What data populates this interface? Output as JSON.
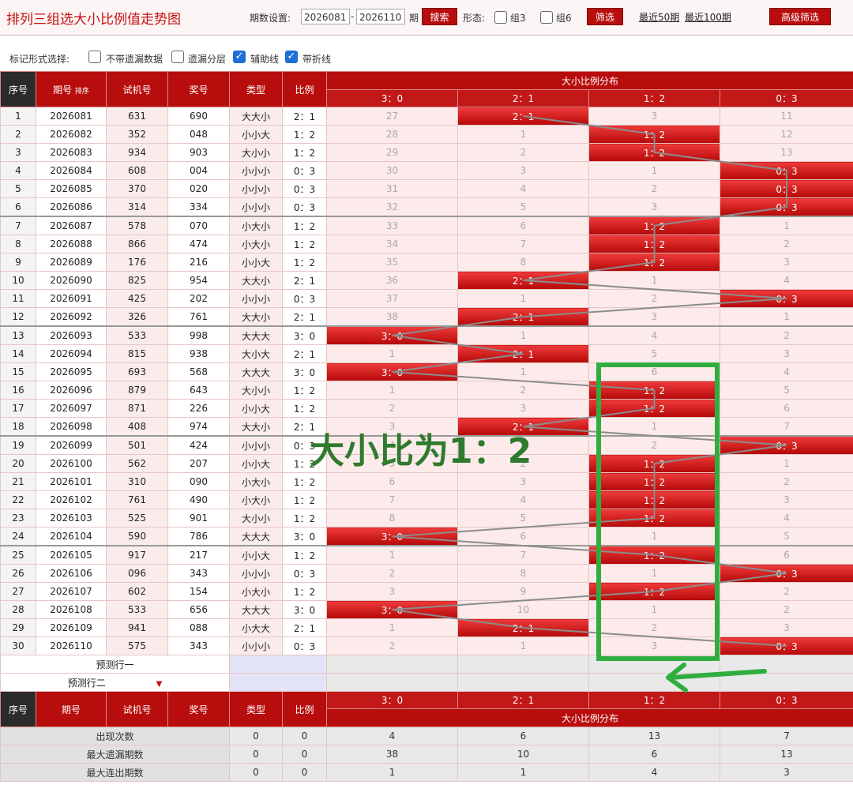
{
  "header": {
    "title": "排列三组选大小比例值走势图",
    "period_label": "期数设置:",
    "start": "2026081",
    "dash": "-",
    "end": "2026110",
    "period_suffix": "期",
    "search": "搜索",
    "shape_label": "形态:",
    "g3": "组3",
    "g6": "组6",
    "filter": "筛选",
    "recent50": "最近50期",
    "recent100": "最近100期",
    "advanced": "高级筛选"
  },
  "options": {
    "label": "标记形式选择:",
    "items": [
      {
        "label": "不带遗漏数据",
        "checked": false
      },
      {
        "label": "遗漏分层",
        "checked": false
      },
      {
        "label": "辅助线",
        "checked": true
      },
      {
        "label": "带折线",
        "checked": true
      }
    ]
  },
  "table": {
    "headers": {
      "seq": "序号",
      "issue": "期号",
      "sort": "排序",
      "test": "试机号",
      "prize": "奖号",
      "type": "类型",
      "ratio": "比例",
      "dist": "大小比例分布"
    },
    "columns": [
      "3：0",
      "2：1",
      "1：2",
      "0：3"
    ],
    "rows": [
      {
        "seq": "1",
        "issue": "2026081",
        "test": "631",
        "prize": "690",
        "type": "大大小",
        "ratio": "2：1",
        "d": [
          "27",
          "2：1",
          "3",
          "11"
        ],
        "hit": 1
      },
      {
        "seq": "2",
        "issue": "2026082",
        "test": "352",
        "prize": "048",
        "type": "小小大",
        "ratio": "1：2",
        "d": [
          "28",
          "1",
          "1：2",
          "12"
        ],
        "hit": 2
      },
      {
        "seq": "3",
        "issue": "2026083",
        "test": "934",
        "prize": "903",
        "type": "大小小",
        "ratio": "1：2",
        "d": [
          "29",
          "2",
          "1：2",
          "13"
        ],
        "hit": 2
      },
      {
        "seq": "4",
        "issue": "2026084",
        "test": "608",
        "prize": "004",
        "type": "小小小",
        "ratio": "0：3",
        "d": [
          "30",
          "3",
          "1",
          "0：3"
        ],
        "hit": 3
      },
      {
        "seq": "5",
        "issue": "2026085",
        "test": "370",
        "prize": "020",
        "type": "小小小",
        "ratio": "0：3",
        "d": [
          "31",
          "4",
          "2",
          "0：3"
        ],
        "hit": 3
      },
      {
        "seq": "6",
        "issue": "2026086",
        "test": "314",
        "prize": "334",
        "type": "小小小",
        "ratio": "0：3",
        "d": [
          "32",
          "5",
          "3",
          "0：3"
        ],
        "hit": 3
      },
      {
        "seq": "7",
        "issue": "2026087",
        "test": "578",
        "prize": "070",
        "type": "小大小",
        "ratio": "1：2",
        "d": [
          "33",
          "6",
          "1：2",
          "1"
        ],
        "hit": 2
      },
      {
        "seq": "8",
        "issue": "2026088",
        "test": "866",
        "prize": "474",
        "type": "小大小",
        "ratio": "1：2",
        "d": [
          "34",
          "7",
          "1：2",
          "2"
        ],
        "hit": 2
      },
      {
        "seq": "9",
        "issue": "2026089",
        "test": "176",
        "prize": "216",
        "type": "小小大",
        "ratio": "1：2",
        "d": [
          "35",
          "8",
          "1：2",
          "3"
        ],
        "hit": 2
      },
      {
        "seq": "10",
        "issue": "2026090",
        "test": "825",
        "prize": "954",
        "type": "大大小",
        "ratio": "2：1",
        "d": [
          "36",
          "2：1",
          "1",
          "4"
        ],
        "hit": 1
      },
      {
        "seq": "11",
        "issue": "2026091",
        "test": "425",
        "prize": "202",
        "type": "小小小",
        "ratio": "0：3",
        "d": [
          "37",
          "1",
          "2",
          "0：3"
        ],
        "hit": 3
      },
      {
        "seq": "12",
        "issue": "2026092",
        "test": "326",
        "prize": "761",
        "type": "大大小",
        "ratio": "2：1",
        "d": [
          "38",
          "2：1",
          "3",
          "1"
        ],
        "hit": 1
      },
      {
        "seq": "13",
        "issue": "2026093",
        "test": "533",
        "prize": "998",
        "type": "大大大",
        "ratio": "3：0",
        "d": [
          "3：0",
          "1",
          "4",
          "2"
        ],
        "hit": 0
      },
      {
        "seq": "14",
        "issue": "2026094",
        "test": "815",
        "prize": "938",
        "type": "大小大",
        "ratio": "2：1",
        "d": [
          "1",
          "2：1",
          "5",
          "3"
        ],
        "hit": 1
      },
      {
        "seq": "15",
        "issue": "2026095",
        "test": "693",
        "prize": "568",
        "type": "大大大",
        "ratio": "3：0",
        "d": [
          "3：0",
          "1",
          "6",
          "4"
        ],
        "hit": 0
      },
      {
        "seq": "16",
        "issue": "2026096",
        "test": "879",
        "prize": "643",
        "type": "大小小",
        "ratio": "1：2",
        "d": [
          "1",
          "2",
          "1：2",
          "5"
        ],
        "hit": 2
      },
      {
        "seq": "17",
        "issue": "2026097",
        "test": "871",
        "prize": "226",
        "type": "小小大",
        "ratio": "1：2",
        "d": [
          "2",
          "3",
          "1：2",
          "6"
        ],
        "hit": 2
      },
      {
        "seq": "18",
        "issue": "2026098",
        "test": "408",
        "prize": "974",
        "type": "大大小",
        "ratio": "2：1",
        "d": [
          "3",
          "2：1",
          "1",
          "7"
        ],
        "hit": 1
      },
      {
        "seq": "19",
        "issue": "2026099",
        "test": "501",
        "prize": "424",
        "type": "小小小",
        "ratio": "0：3",
        "d": [
          "4",
          "1",
          "2",
          "0：3"
        ],
        "hit": 3
      },
      {
        "seq": "20",
        "issue": "2026100",
        "test": "562",
        "prize": "207",
        "type": "小小大",
        "ratio": "1：2",
        "d": [
          "5",
          "2",
          "1：2",
          "1"
        ],
        "hit": 2
      },
      {
        "seq": "21",
        "issue": "2026101",
        "test": "310",
        "prize": "090",
        "type": "小大小",
        "ratio": "1：2",
        "d": [
          "6",
          "3",
          "1：2",
          "2"
        ],
        "hit": 2
      },
      {
        "seq": "22",
        "issue": "2026102",
        "test": "761",
        "prize": "490",
        "type": "小大小",
        "ratio": "1：2",
        "d": [
          "7",
          "4",
          "1：2",
          "3"
        ],
        "hit": 2
      },
      {
        "seq": "23",
        "issue": "2026103",
        "test": "525",
        "prize": "901",
        "type": "大小小",
        "ratio": "1：2",
        "d": [
          "8",
          "5",
          "1：2",
          "4"
        ],
        "hit": 2
      },
      {
        "seq": "24",
        "issue": "2026104",
        "test": "590",
        "prize": "786",
        "type": "大大大",
        "ratio": "3：0",
        "d": [
          "3：0",
          "6",
          "1",
          "5"
        ],
        "hit": 0
      },
      {
        "seq": "25",
        "issue": "2026105",
        "test": "917",
        "prize": "217",
        "type": "小小大",
        "ratio": "1：2",
        "d": [
          "1",
          "7",
          "1：2",
          "6"
        ],
        "hit": 2
      },
      {
        "seq": "26",
        "issue": "2026106",
        "test": "096",
        "prize": "343",
        "type": "小小小",
        "ratio": "0：3",
        "d": [
          "2",
          "8",
          "1",
          "0：3"
        ],
        "hit": 3
      },
      {
        "seq": "27",
        "issue": "2026107",
        "test": "602",
        "prize": "154",
        "type": "小大小",
        "ratio": "1：2",
        "d": [
          "3",
          "9",
          "1：2",
          "2"
        ],
        "hit": 2
      },
      {
        "seq": "28",
        "issue": "2026108",
        "test": "533",
        "prize": "656",
        "type": "大大大",
        "ratio": "3：0",
        "d": [
          "3：0",
          "10",
          "1",
          "2"
        ],
        "hit": 0
      },
      {
        "seq": "29",
        "issue": "2026109",
        "test": "941",
        "prize": "088",
        "type": "小大大",
        "ratio": "2：1",
        "d": [
          "1",
          "2：1",
          "2",
          "3"
        ],
        "hit": 1
      },
      {
        "seq": "30",
        "issue": "2026110",
        "test": "575",
        "prize": "343",
        "type": "小小小",
        "ratio": "0：3",
        "d": [
          "2",
          "1",
          "3",
          "0：3"
        ],
        "hit": 3
      }
    ],
    "pred1": "预测行一",
    "pred2": "预测行二",
    "stats": [
      {
        "label": "出现次数",
        "a": "0",
        "b": "0",
        "d": [
          "4",
          "6",
          "13",
          "7"
        ]
      },
      {
        "label": "最大遗漏期数",
        "a": "0",
        "b": "0",
        "d": [
          "38",
          "10",
          "6",
          "13"
        ]
      },
      {
        "label": "最大连出期数",
        "a": "0",
        "b": "0",
        "d": [
          "1",
          "1",
          "4",
          "3"
        ]
      }
    ]
  },
  "annotation": {
    "text": "大小比为1：2",
    "color": "#2fae3f"
  }
}
